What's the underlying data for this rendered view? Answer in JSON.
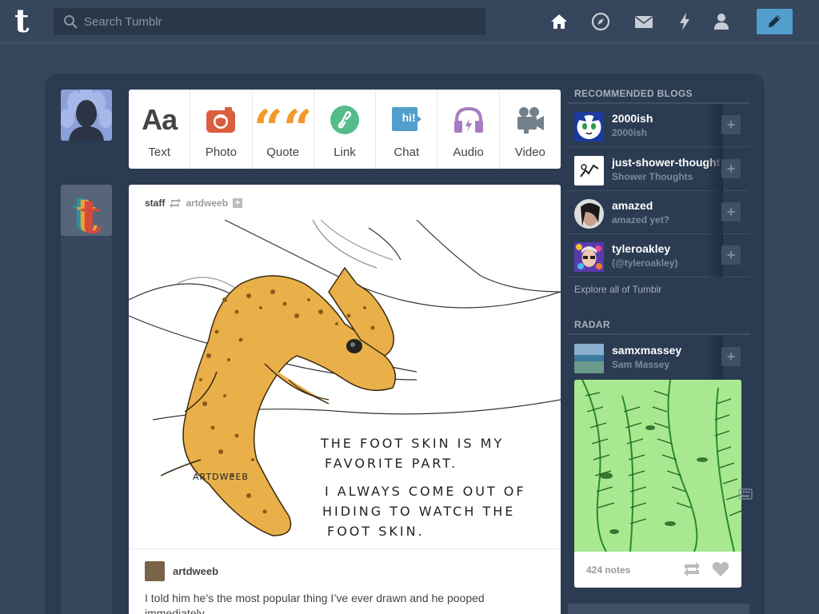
{
  "header": {
    "logo": "t",
    "search_placeholder": "Search Tumblr",
    "nav_icons": [
      "home-icon",
      "explore-compass-icon",
      "inbox-mail-icon",
      "activity-lightning-icon",
      "account-person-icon"
    ],
    "compose_icon": "pencil-icon",
    "compose_color": "#529ecc"
  },
  "post_types": [
    {
      "label": "Text",
      "icon": "text-aa-icon",
      "glyph": "Aa",
      "color": "#444444"
    },
    {
      "label": "Photo",
      "icon": "camera-icon",
      "color": "#d95e40"
    },
    {
      "label": "Quote",
      "icon": "quote-icon",
      "glyph": "““",
      "color": "#f2992e"
    },
    {
      "label": "Link",
      "icon": "link-icon",
      "color": "#56bc8a"
    },
    {
      "label": "Chat",
      "icon": "chat-bubble-icon",
      "glyph": "hi!",
      "color": "#529ecc"
    },
    {
      "label": "Audio",
      "icon": "headphones-icon",
      "color": "#a77dc2"
    },
    {
      "label": "Video",
      "icon": "video-camera-icon",
      "color": "#748089"
    }
  ],
  "post": {
    "author": "staff",
    "reblogged_from": "artdweeb",
    "art_text": {
      "signature": "ARTDWEEB",
      "line1": "THE FOOT SKIN IS MY",
      "line2": "FAVORITE PART.",
      "line3": "I ALWAYS COME OUT OF",
      "line4": "HIDING TO WATCH THE",
      "line5": "FOOT SKIN."
    },
    "caption_author": "artdweeb",
    "caption": "I told him he’s the most popular thing I’ve ever drawn and he pooped immediately."
  },
  "sidebar": {
    "recommended_title": "RECOMMENDED BLOGS",
    "blogs": [
      {
        "name": "2000ish",
        "sub": "2000ish"
      },
      {
        "name": "just-shower-thoughts",
        "sub": "Shower Thoughts"
      },
      {
        "name": "amazed",
        "sub": "amazed yet?"
      },
      {
        "name": "tyleroakley",
        "sub": "(@tyleroakley)"
      }
    ],
    "follow_label": "+",
    "explore_label": "Explore all of Tumblr",
    "radar_title": "RADAR",
    "radar_blog": {
      "name": "samxmassey",
      "sub": "Sam Massey"
    },
    "radar_notes": "424 notes"
  }
}
